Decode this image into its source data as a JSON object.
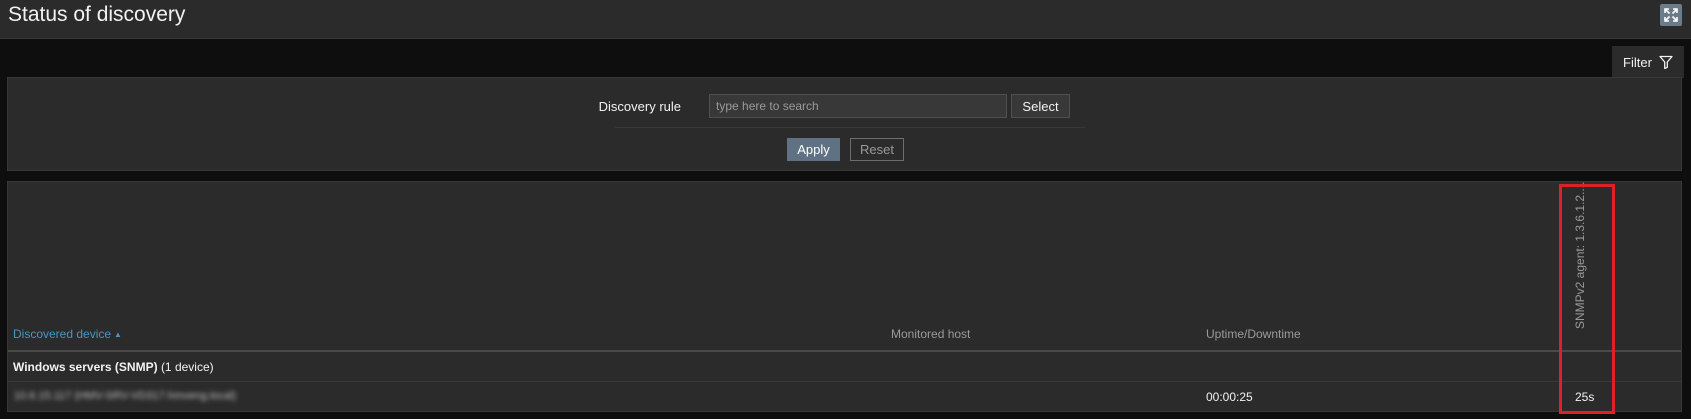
{
  "page": {
    "title": "Status of discovery",
    "fullscreen_icon": "fullscreen-icon"
  },
  "filter": {
    "tab_label": "Filter",
    "tab_icon": "funnel-icon",
    "discovery_rule_label": "Discovery rule",
    "discovery_rule_placeholder": "type here to search",
    "discovery_rule_value": "",
    "select_label": "Select",
    "apply_label": "Apply",
    "reset_label": "Reset"
  },
  "table": {
    "columns": {
      "discovered_device": "Discovered device",
      "sort_indicator": "▲",
      "monitored_host": "Monitored host",
      "uptime_downtime": "Uptime/Downtime",
      "service": "SNMPv2 agent: 1.3.6.1.2...."
    },
    "group": {
      "name": "Windows servers (SNMP)",
      "count": "(1 device)"
    },
    "rows": [
      {
        "device": "10.6.15.117 (HMV-SRV-VD317.hmveng.local)",
        "monitored_host": "",
        "uptime": "00:00:25",
        "service": "25s"
      }
    ]
  },
  "colors": {
    "background": "#0e0e0e",
    "panel": "#2b2b2b",
    "link": "#4796c4",
    "apply_button": "#5f7283",
    "highlight": "#e02028"
  }
}
